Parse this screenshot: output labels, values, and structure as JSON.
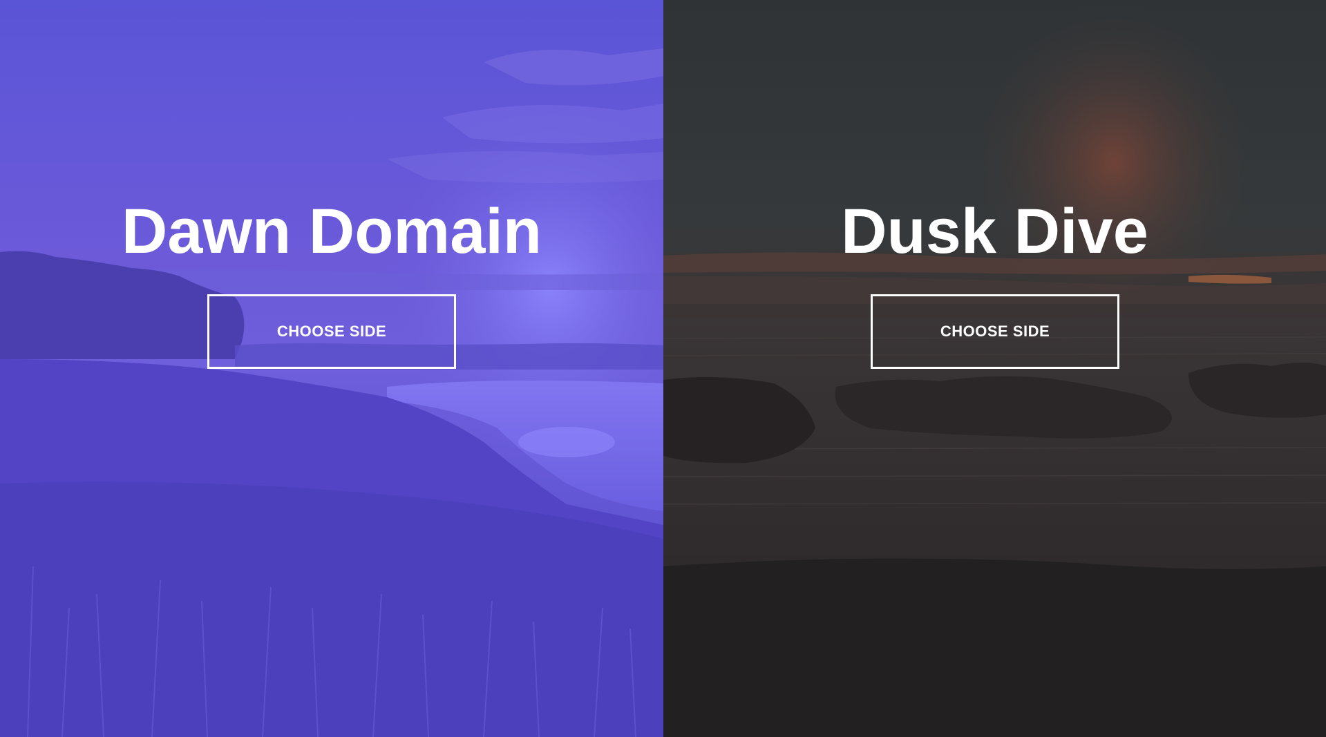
{
  "left": {
    "title": "Dawn Domain",
    "button_label": "CHOOSE SIDE",
    "overlay_color": "#5b52d8",
    "accent_color": "#8a7bff"
  },
  "right": {
    "title": "Dusk Dive",
    "button_label": "CHOOSE SIDE",
    "overlay_color": "#2b2b2e",
    "accent_color": "#8a4a3a"
  }
}
